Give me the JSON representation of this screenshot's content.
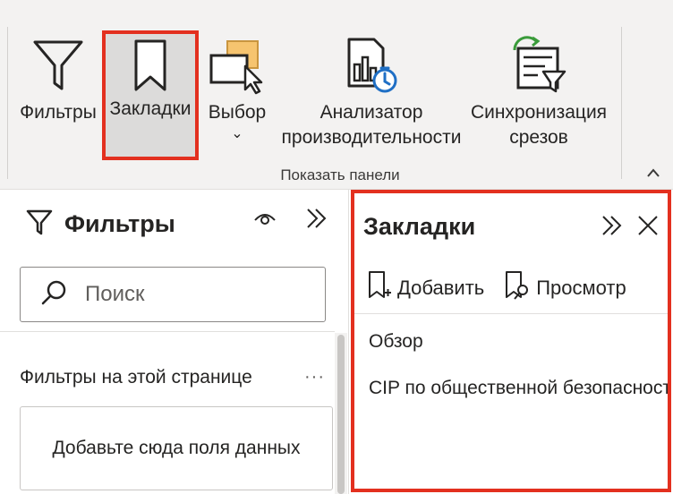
{
  "ribbon": {
    "buttons": {
      "filters": {
        "label": "Фильтры",
        "icon": "filter-icon"
      },
      "bookmarks": {
        "label": "Закладки",
        "icon": "bookmark-icon",
        "selected": true
      },
      "selection": {
        "label": "Выбор",
        "icon": "selection-pane-icon",
        "dropdown": "⌄"
      },
      "performance_analyzer": {
        "label_line1": "Анализатор",
        "label_line2": "производительности",
        "icon": "performance-analyzer-icon"
      },
      "sync_slicers": {
        "label_line1": "Синхронизация",
        "label_line2": "срезов",
        "icon": "sync-slicers-icon"
      }
    },
    "group_label": "Показать панели",
    "collapse_icon": "chevron-up-icon"
  },
  "filters_pane": {
    "title": "Фильтры",
    "search": {
      "placeholder": "Поиск"
    },
    "section_label": "Фильтры на этой странице",
    "more_label": "···",
    "drop_hint": "Добавьте сюда поля данных"
  },
  "bookmarks_pane": {
    "title": "Закладки",
    "add_label": "Добавить",
    "view_label": "Просмотр",
    "items": [
      {
        "label": "Обзор"
      },
      {
        "label": "CIP по общественной безопасности"
      }
    ]
  },
  "colors": {
    "highlight_border": "#e3301f",
    "ribbon_bg": "#f3f2f1",
    "selected_bg": "#dcdbda",
    "accent_green": "#3a9b3a",
    "accent_blue": "#1f6fc5",
    "accent_orange": "#f6c46f"
  }
}
